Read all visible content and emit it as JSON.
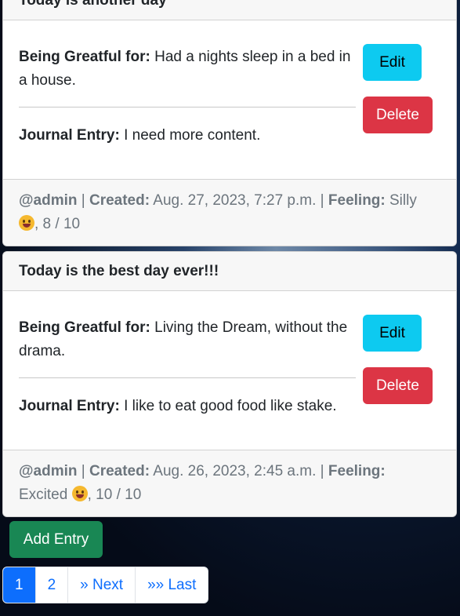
{
  "entries": [
    {
      "title": "Today is another day",
      "grateful_label": "Being Greatful for:",
      "grateful_text": " Had a nights sleep in a bed in a house.",
      "journal_label": "Journal Entry:",
      "journal_text": " I need more content.",
      "edit_label": "Edit",
      "delete_label": "Delete",
      "user": "@admin",
      "sep1": " | ",
      "created_label": "Created:",
      "created": " Aug. 27, 2023, 7:27 p.m.",
      "sep2": " | ",
      "feeling_label": "Feeling:",
      "feeling": " Silly ",
      "rating": ", 8 / 10"
    },
    {
      "title": "Today is the best day ever!!!",
      "grateful_label": "Being Greatful for:",
      "grateful_text": " Living the Dream, without the drama.",
      "journal_label": "Journal Entry:",
      "journal_text": " I like to eat good food like stake.",
      "edit_label": "Edit",
      "delete_label": "Delete",
      "user": "@admin",
      "sep1": " | ",
      "created_label": "Created:",
      "created": " Aug. 26, 2023, 2:45 a.m.",
      "sep2": " | ",
      "feeling_label": "Feeling:",
      "feeling": " Excited ",
      "rating": ", 10 / 10"
    }
  ],
  "add_entry_label": "Add Entry",
  "pagination": {
    "page1": "1",
    "page2": "2",
    "next": "» Next",
    "last": "»» Last"
  },
  "colors": {
    "edit": "#0dcaf0",
    "delete": "#dc3545",
    "add": "#198754",
    "primary": "#0d6efd"
  }
}
